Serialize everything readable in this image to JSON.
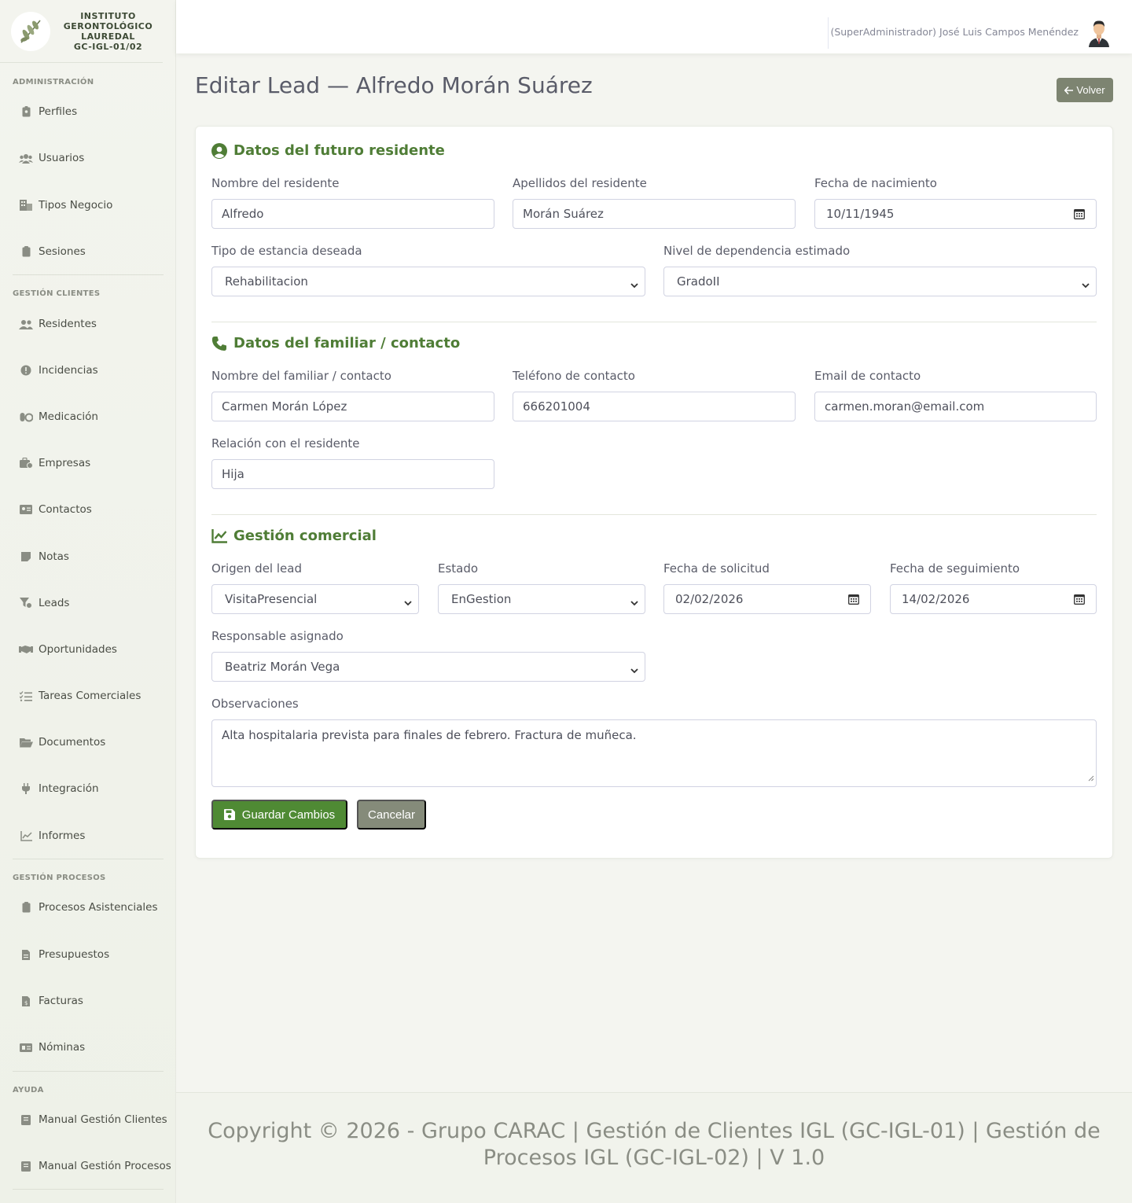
{
  "brand": {
    "line1": "INSTITUTO",
    "line2": "GERONTOLÓGICO",
    "line3": "LAUREDAL",
    "line4": "GC-IGL-01/02"
  },
  "sidebar": {
    "admin_heading": "ADMINISTRACIÓN",
    "admin_items": [
      {
        "label": "Perfiles",
        "icon": "id-badge-icon"
      },
      {
        "label": "Usuarios",
        "icon": "users-icon"
      },
      {
        "label": "Tipos Negocio",
        "icon": "building-icon"
      },
      {
        "label": "Sesiones",
        "icon": "clipboard-icon"
      }
    ],
    "clients_heading": "GESTIÓN CLIENTES",
    "clients_items": [
      {
        "label": "Residentes",
        "icon": "user-friends-icon"
      },
      {
        "label": "Incidencias",
        "icon": "exclamation-circle-icon"
      },
      {
        "label": "Medicación",
        "icon": "pills-icon"
      },
      {
        "label": "Empresas",
        "icon": "briefcase-icon"
      },
      {
        "label": "Contactos",
        "icon": "address-card-icon"
      },
      {
        "label": "Notas",
        "icon": "sticky-note-icon"
      },
      {
        "label": "Leads",
        "icon": "funnel-icon"
      },
      {
        "label": "Oportunidades",
        "icon": "handshake-icon"
      },
      {
        "label": "Tareas Comerciales",
        "icon": "tasks-icon"
      },
      {
        "label": "Documentos",
        "icon": "folder-open-icon"
      },
      {
        "label": "Integración",
        "icon": "plug-icon"
      },
      {
        "label": "Informes",
        "icon": "chart-line-icon"
      }
    ],
    "processes_heading": "GESTIÓN PROCESOS",
    "processes_items": [
      {
        "label": "Procesos Asistenciales",
        "icon": "clipboard-icon"
      },
      {
        "label": "Presupuestos",
        "icon": "file-icon"
      },
      {
        "label": "Facturas",
        "icon": "invoice-icon"
      },
      {
        "label": "Nóminas",
        "icon": "money-check-icon"
      }
    ],
    "help_heading": "AYUDA",
    "help_items": [
      {
        "label": "Manual Gestión Clientes",
        "icon": "book-icon"
      },
      {
        "label": "Manual Gestión Procesos",
        "icon": "book-icon"
      }
    ]
  },
  "topbar": {
    "user_name": "(SuperAdministrador) José Luis Campos Menéndez"
  },
  "page": {
    "title": "Editar Lead — Alfredo Morán Suárez",
    "back_label": "Volver"
  },
  "sections": {
    "resident": {
      "title": "Datos del futuro residente",
      "nombre_label": "Nombre del residente",
      "nombre_value": "Alfredo",
      "apellidos_label": "Apellidos del residente",
      "apellidos_value": "Morán Suárez",
      "fecha_nac_label": "Fecha de nacimiento",
      "fecha_nac_value": "10/11/1945",
      "estancia_label": "Tipo de estancia deseada",
      "estancia_value": "Rehabilitacion",
      "dependencia_label": "Nivel de dependencia estimado",
      "dependencia_value": "GradoII"
    },
    "contact": {
      "title": "Datos del familiar / contacto",
      "nombre_label": "Nombre del familiar / contacto",
      "nombre_value": "Carmen Morán López",
      "telefono_label": "Teléfono de contacto",
      "telefono_value": "666201004",
      "email_label": "Email de contacto",
      "email_value": "carmen.moran@email.com",
      "relacion_label": "Relación con el residente",
      "relacion_value": "Hija"
    },
    "commercial": {
      "title": "Gestión comercial",
      "origen_label": "Origen del lead",
      "origen_value": "VisitaPresencial",
      "estado_label": "Estado",
      "estado_value": "EnGestion",
      "fecha_sol_label": "Fecha de solicitud",
      "fecha_sol_value": "02/02/2026",
      "fecha_seg_label": "Fecha de seguimiento",
      "fecha_seg_value": "14/02/2026",
      "responsable_label": "Responsable asignado",
      "responsable_value": "Beatriz Morán Vega",
      "observaciones_label": "Observaciones",
      "observaciones_value": "Alta hospitalaria prevista para finales de febrero. Fractura de muñeca."
    }
  },
  "actions": {
    "save_label": "Guardar Cambios",
    "cancel_label": "Cancelar"
  },
  "footer": {
    "text": "Copyright © 2026 - Grupo CARAC | Gestión de Clientes IGL (GC-IGL-01) | Gestión de Procesos IGL (GC-IGL-02) | V 1.0"
  },
  "colors": {
    "accent_green": "#4f7d36",
    "save_button": "#4f8a34",
    "secondary_button": "#858b7a"
  }
}
